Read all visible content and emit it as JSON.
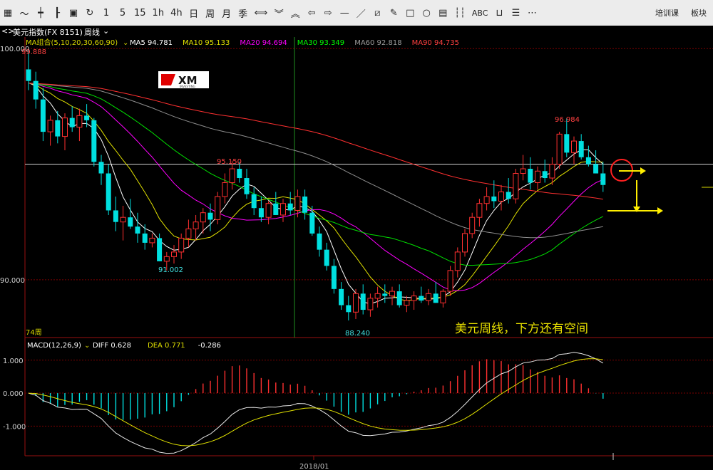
{
  "toolbar": {
    "left": [
      {
        "name": "grid-icon",
        "glyph": "▦"
      },
      {
        "name": "line-chart-icon",
        "glyph": "〜"
      },
      {
        "name": "candle-icon",
        "glyph": "┿"
      },
      {
        "name": "bar-icon",
        "glyph": "┠"
      },
      {
        "name": "save-icon",
        "glyph": "▣"
      },
      {
        "name": "refresh-icon",
        "glyph": "↻"
      },
      {
        "name": "period-1",
        "glyph": "1"
      },
      {
        "name": "period-5",
        "glyph": "5"
      },
      {
        "name": "period-15",
        "glyph": "15"
      },
      {
        "name": "period-1h",
        "glyph": "1h"
      },
      {
        "name": "period-4h",
        "glyph": "4h"
      },
      {
        "name": "period-day",
        "glyph": "日"
      },
      {
        "name": "period-week",
        "glyph": "周"
      },
      {
        "name": "period-month",
        "glyph": "月"
      },
      {
        "name": "period-quarter",
        "glyph": "季"
      },
      {
        "name": "arrows-lr-icon",
        "glyph": "⟺"
      },
      {
        "name": "chevron-down-icon",
        "glyph": "︾"
      },
      {
        "name": "chevron-up-icon",
        "glyph": "︽"
      },
      {
        "name": "arrow-left-icon",
        "glyph": "⇦"
      },
      {
        "name": "arrow-right-icon",
        "glyph": "⇨"
      },
      {
        "name": "hline-icon",
        "glyph": "—"
      },
      {
        "name": "trendline-icon",
        "glyph": "／"
      },
      {
        "name": "channel-icon",
        "glyph": "⧄"
      },
      {
        "name": "pen-icon",
        "glyph": "✎"
      },
      {
        "name": "rect-icon",
        "glyph": "□"
      },
      {
        "name": "circle-icon",
        "glyph": "○"
      },
      {
        "name": "text-box-icon",
        "glyph": "▤"
      },
      {
        "name": "vlines-icon",
        "glyph": "┆┆"
      },
      {
        "name": "abc-icon",
        "glyph": "ABC"
      },
      {
        "name": "ruler-icon",
        "glyph": "⊔"
      },
      {
        "name": "fib-icon",
        "glyph": "☰"
      },
      {
        "name": "more-icon",
        "glyph": "⋯"
      }
    ],
    "right": [
      "培训课",
      "板块"
    ]
  },
  "title": {
    "prefix": "<>",
    "symbol": "美元指数(FX 8151)",
    "period": "周线"
  },
  "ma_legend": [
    {
      "label": "MA组合(5,10,20,30,60,90)",
      "color": "#d8d800"
    },
    {
      "label": "MA5 94.781",
      "color": "#ffffff"
    },
    {
      "label": "MA10 95.133",
      "color": "#e0e000"
    },
    {
      "label": "MA20 94.694",
      "color": "#ff00ff"
    },
    {
      "label": "MA30 93.349",
      "color": "#00ff00"
    },
    {
      "label": "MA60 92.818",
      "color": "#9a9a9a"
    },
    {
      "label": "MA90 94.735",
      "color": "#ff4040"
    }
  ],
  "price_axis": {
    "ticks": [
      "100.000",
      "90.000"
    ]
  },
  "macd_legend": [
    {
      "label": "MACD(12,26,9)",
      "color": "#ffffff"
    },
    {
      "label": "DIFF 0.628",
      "color": "#ffffff"
    },
    {
      "label": "DEA 0.771",
      "color": "#e0e000"
    },
    {
      "label": "-0.286",
      "color": "#ffffff"
    }
  ],
  "macd_axis": {
    "ticks": [
      "1.000",
      "0.000",
      "-1.000"
    ]
  },
  "x_date": "2018/01",
  "label_74": "74周",
  "annotations": {
    "high_left": "99.888",
    "low1": "91.002",
    "peak": "95.150",
    "low2": "88.240",
    "high_right": "96.984",
    "comment": "美元周线，下方还有空间"
  },
  "logo": {
    "text": "XM",
    "sub": "INVESTING"
  },
  "colors": {
    "up": "#ff3030",
    "down": "#00e0e0",
    "grid": "#7a0000",
    "axis": "#9a1010"
  },
  "chart_data": {
    "type": "candlestick",
    "ylim": [
      87.5,
      100.5
    ],
    "values_ohlc": [
      [
        99.1,
        99.888,
        98.2,
        98.6
      ],
      [
        98.6,
        99.0,
        97.4,
        97.8
      ],
      [
        97.8,
        98.3,
        96.0,
        96.4
      ],
      [
        96.4,
        97.1,
        95.8,
        96.9
      ],
      [
        96.9,
        97.3,
        95.9,
        96.2
      ],
      [
        96.2,
        97.2,
        95.6,
        97.0
      ],
      [
        97.0,
        97.5,
        96.4,
        96.6
      ],
      [
        96.6,
        97.4,
        96.0,
        97.1
      ],
      [
        97.1,
        97.6,
        96.6,
        96.9
      ],
      [
        96.9,
        97.0,
        94.9,
        95.1
      ],
      [
        95.1,
        95.4,
        94.1,
        94.6
      ],
      [
        94.6,
        95.0,
        92.8,
        93.0
      ],
      [
        93.0,
        93.6,
        92.1,
        92.5
      ],
      [
        92.5,
        93.2,
        91.7,
        92.7
      ],
      [
        92.7,
        93.5,
        92.2,
        92.3
      ],
      [
        92.3,
        92.9,
        91.6,
        92.0
      ],
      [
        92.0,
        92.4,
        91.3,
        91.6
      ],
      [
        91.6,
        92.0,
        91.4,
        91.8
      ],
      [
        91.8,
        92.0,
        90.8,
        90.8
      ],
      [
        90.8,
        91.2,
        90.4,
        91.002
      ],
      [
        91.002,
        91.5,
        90.7,
        91.2
      ],
      [
        91.2,
        92.0,
        90.9,
        91.8
      ],
      [
        91.8,
        92.6,
        91.4,
        92.2
      ],
      [
        92.2,
        92.8,
        91.7,
        92.5
      ],
      [
        92.5,
        93.1,
        92.0,
        92.9
      ],
      [
        92.9,
        93.3,
        92.1,
        92.6
      ],
      [
        92.6,
        93.8,
        92.4,
        93.6
      ],
      [
        93.6,
        94.6,
        93.3,
        94.2
      ],
      [
        94.2,
        95.15,
        93.9,
        94.8
      ],
      [
        94.8,
        95.1,
        94.2,
        94.4
      ],
      [
        94.4,
        94.8,
        93.5,
        93.7
      ],
      [
        93.7,
        94.0,
        92.8,
        93.1
      ],
      [
        93.1,
        93.6,
        92.5,
        92.7
      ],
      [
        92.7,
        93.4,
        92.4,
        93.3
      ],
      [
        93.3,
        93.8,
        92.8,
        92.8
      ],
      [
        92.8,
        93.5,
        92.5,
        93.3
      ],
      [
        93.3,
        93.8,
        92.8,
        93.0
      ],
      [
        93.0,
        93.9,
        92.7,
        93.6
      ],
      [
        93.6,
        93.9,
        92.6,
        92.9
      ],
      [
        92.9,
        93.2,
        91.9,
        92.0
      ],
      [
        92.0,
        92.3,
        91.0,
        91.3
      ],
      [
        91.3,
        91.6,
        90.4,
        90.6
      ],
      [
        90.6,
        90.9,
        89.4,
        89.6
      ],
      [
        89.6,
        89.9,
        88.7,
        88.9
      ],
      [
        88.9,
        89.3,
        88.24,
        88.6
      ],
      [
        88.6,
        89.6,
        88.3,
        89.4
      ],
      [
        89.4,
        89.8,
        88.5,
        88.7
      ],
      [
        88.7,
        89.4,
        88.4,
        89.2
      ],
      [
        89.2,
        89.7,
        88.8,
        89.4
      ],
      [
        89.4,
        89.8,
        89.0,
        89.3
      ],
      [
        89.3,
        89.7,
        88.9,
        89.5
      ],
      [
        89.5,
        89.8,
        88.8,
        88.9
      ],
      [
        88.9,
        89.3,
        88.6,
        89.1
      ],
      [
        89.1,
        89.5,
        88.7,
        89.3
      ],
      [
        89.3,
        89.7,
        89.0,
        89.1
      ],
      [
        89.1,
        89.6,
        88.9,
        89.4
      ],
      [
        89.4,
        89.9,
        89.0,
        89.0
      ],
      [
        89.0,
        89.6,
        88.8,
        89.5
      ],
      [
        89.5,
        90.6,
        89.3,
        90.4
      ],
      [
        90.4,
        91.4,
        90.1,
        91.2
      ],
      [
        91.2,
        92.2,
        91.0,
        92.0
      ],
      [
        92.0,
        92.9,
        91.8,
        92.7
      ],
      [
        92.7,
        93.5,
        92.3,
        93.3
      ],
      [
        93.3,
        94.0,
        93.0,
        93.6
      ],
      [
        93.6,
        94.3,
        93.1,
        93.4
      ],
      [
        93.4,
        94.1,
        93.0,
        93.8
      ],
      [
        93.8,
        94.4,
        93.3,
        93.5
      ],
      [
        93.5,
        94.8,
        93.3,
        94.6
      ],
      [
        94.6,
        95.4,
        94.3,
        94.8
      ],
      [
        94.8,
        95.3,
        93.9,
        94.2
      ],
      [
        94.2,
        94.9,
        93.9,
        94.7
      ],
      [
        94.7,
        95.2,
        94.2,
        94.4
      ],
      [
        94.4,
        95.3,
        94.1,
        95.0
      ],
      [
        95.0,
        96.4,
        94.8,
        96.3
      ],
      [
        96.3,
        96.984,
        95.3,
        95.5
      ],
      [
        95.5,
        96.2,
        95.0,
        96.0
      ],
      [
        96.0,
        96.3,
        95.2,
        95.3
      ],
      [
        95.3,
        95.8,
        94.9,
        95.0
      ],
      [
        95.0,
        95.6,
        94.6,
        94.6
      ],
      [
        94.6,
        95.1,
        93.8,
        94.1
      ]
    ]
  }
}
